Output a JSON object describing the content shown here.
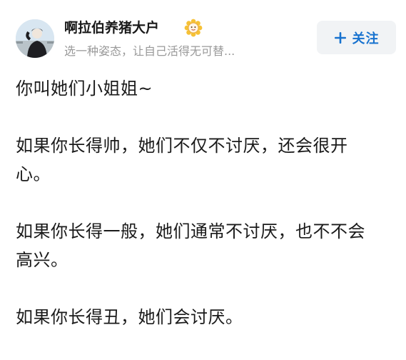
{
  "author": {
    "name": "啊拉伯养猪大户",
    "bio": "选一种姿态，让自己活得无可替...",
    "badge_icon": "sunflower-badge-icon"
  },
  "follow": {
    "icon": "plus-icon",
    "label": "关注",
    "color": "#1772cf"
  },
  "post": {
    "paragraphs": [
      {
        "lines": [
          "你叫她们小姐姐~"
        ]
      },
      {
        "lines": [
          "如果你长得帅，她们不仅不讨厌，还会很开",
          "心。"
        ]
      },
      {
        "lines": [
          "如果你长得一般，她们通常不讨厌，也不不会",
          "高兴。"
        ]
      },
      {
        "lines": [
          "如果你长得丑，她们会讨厌。"
        ]
      }
    ]
  }
}
